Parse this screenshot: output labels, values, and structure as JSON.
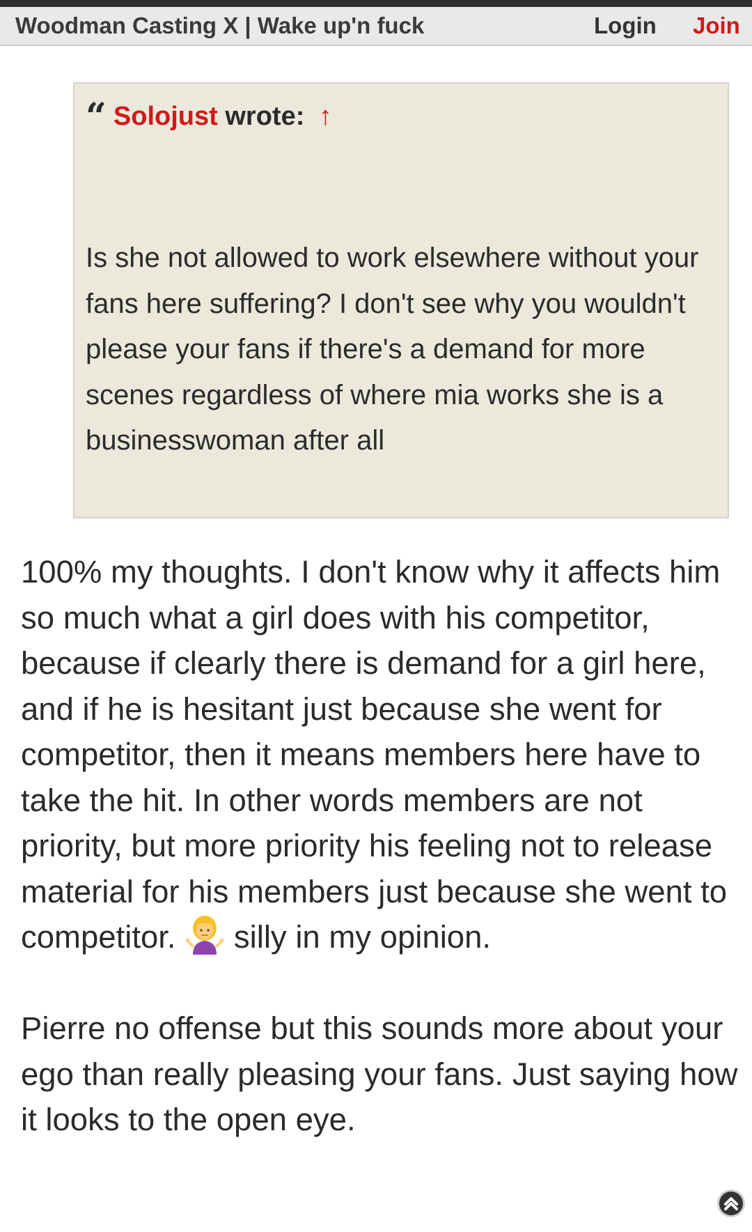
{
  "header": {
    "title": "Woodman Casting X | Wake up'n fuck",
    "login_label": "Login",
    "join_label": "Join"
  },
  "quote": {
    "author": "Solojust",
    "wrote_label": "wrote:",
    "arrow": "↑",
    "quote_icon": "66",
    "body": "Is she not allowed to work elsewhere without your fans here suffering? I don't see why you wouldn't please your fans if there's a demand for more scenes regardless of where mia works she is a businesswoman after all"
  },
  "post": {
    "paragraph1_before_emoji": "100% my thoughts. I don't know why it affects him so much what a girl does with his competitor, because if clearly there is demand for a girl here, and if he is hesitant just because she went for competitor, then it means members here have to take the hit. In other words members are not priority, but more priority his feeling not to release material for his members just because she went to competitor.",
    "paragraph1_after_emoji": "silly in my opinion.",
    "emoji": "person-shrugging",
    "paragraph2": "Pierre no offense but this sounds more about your ego than really pleasing your fans. Just saying how it looks to the open eye."
  },
  "colors": {
    "accent": "#d01919",
    "quote_background": "#ebe9dc",
    "header_background": "#e9e9e9"
  },
  "icons": {
    "scroll_top": "chevron-up-circle-icon",
    "quote": "quote-icon"
  }
}
